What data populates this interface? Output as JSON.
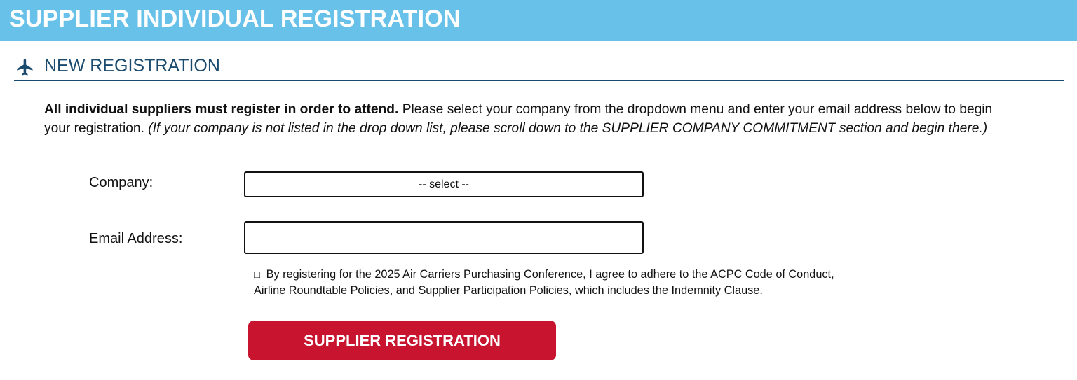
{
  "banner": {
    "title": "SUPPLIER INDIVIDUAL REGISTRATION"
  },
  "section": {
    "title": "NEW REGISTRATION",
    "icon": "airplane-icon"
  },
  "intro": {
    "bold": "All individual suppliers must register in order to attend.",
    "normal": " Please select your company from the dropdown menu and enter your email address below to begin your registration. ",
    "italic": "(If your company is not listed in the drop down list, please scroll down to the SUPPLIER COMPANY COMMITMENT section and begin there.)"
  },
  "form": {
    "company_label": "Company:",
    "company_value": "-- select --",
    "email_label": "Email Address:",
    "email_value": ""
  },
  "agreement": {
    "checkbox": "□",
    "text_before": " By registering for the 2025 Air Carriers Purchasing Conference, I agree to adhere to the ",
    "link_code": "ACPC Code of Conduct",
    "comma": ",",
    "link_roundtable": "Airline Roundtable Policies",
    "and": ", and ",
    "link_supplier": "Supplier Participation Policies",
    "text_after": ", which includes the Indemnity Clause."
  },
  "button": {
    "label": "SUPPLIER REGISTRATION"
  },
  "colors": {
    "banner": "#68c1e9",
    "heading": "#1a4a6e",
    "button": "#c8142f"
  }
}
